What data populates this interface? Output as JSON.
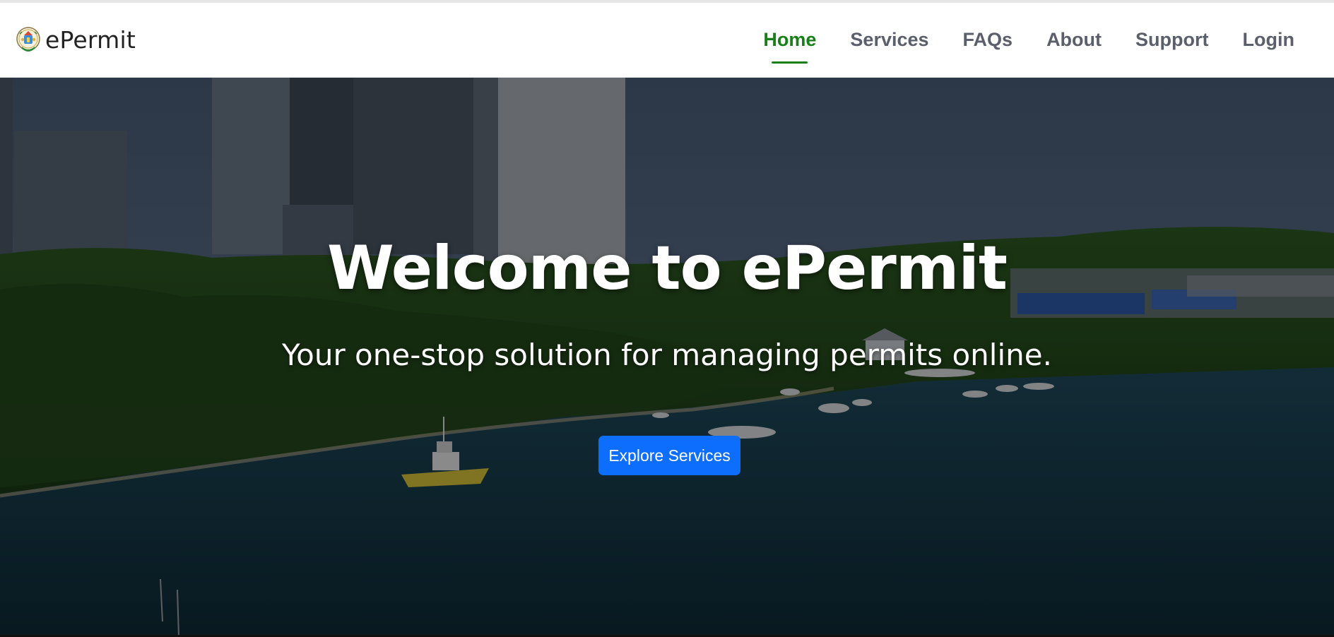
{
  "brand": {
    "name": "ePermit",
    "logo_icon": "coat-of-arms-icon"
  },
  "nav": {
    "items": [
      {
        "label": "Home",
        "active": true
      },
      {
        "label": "Services",
        "active": false
      },
      {
        "label": "FAQs",
        "active": false
      },
      {
        "label": "About",
        "active": false
      },
      {
        "label": "Support",
        "active": false
      },
      {
        "label": "Login",
        "active": false
      }
    ],
    "active_color": "#198019",
    "inactive_color": "#5a5f6b"
  },
  "hero": {
    "title": "Welcome to ePermit",
    "subtitle": "Your one-stop solution for managing permits online.",
    "cta_label": "Explore Services",
    "cta_color": "#0d6efd"
  }
}
